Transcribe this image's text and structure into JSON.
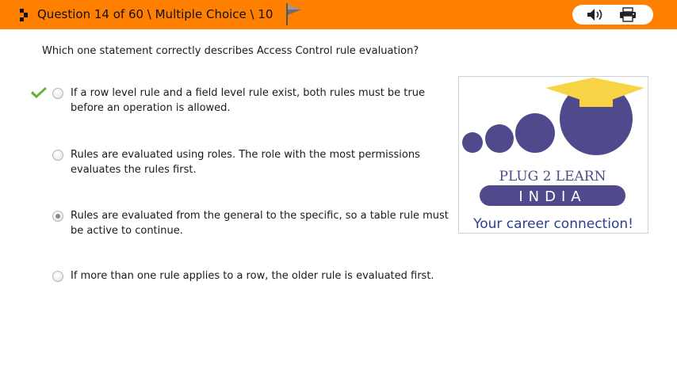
{
  "header": {
    "question_label": "Question 14 of 60 \\ Multiple Choice \\ 10",
    "flag_icon": "flag-icon",
    "speaker_icon": "speaker-icon",
    "printer_icon": "printer-icon",
    "bar_color": "#ff7f00"
  },
  "question": {
    "text": "Which one statement correctly describes Access Control rule evaluation?"
  },
  "options": [
    {
      "text": "If a row level rule and a field level rule exist, both rules must be true before an operation is allowed.",
      "correct": true,
      "selected": false
    },
    {
      "text": "Rules are evaluated using roles. The role with the most permissions evaluates the rules first.",
      "correct": false,
      "selected": false
    },
    {
      "text": "Rules are evaluated from the general to the specific, so a table rule must be active to continue.",
      "correct": false,
      "selected": true
    },
    {
      "text": "If more than one rule applies to a row, the older rule is evaluated first.",
      "correct": false,
      "selected": false
    }
  ],
  "logo": {
    "brand": "PLUG 2 LEARN",
    "country": "INDIA",
    "tagline": "Your career connection!",
    "purple": "#4f4a8c",
    "yellow": "#f7d445"
  }
}
